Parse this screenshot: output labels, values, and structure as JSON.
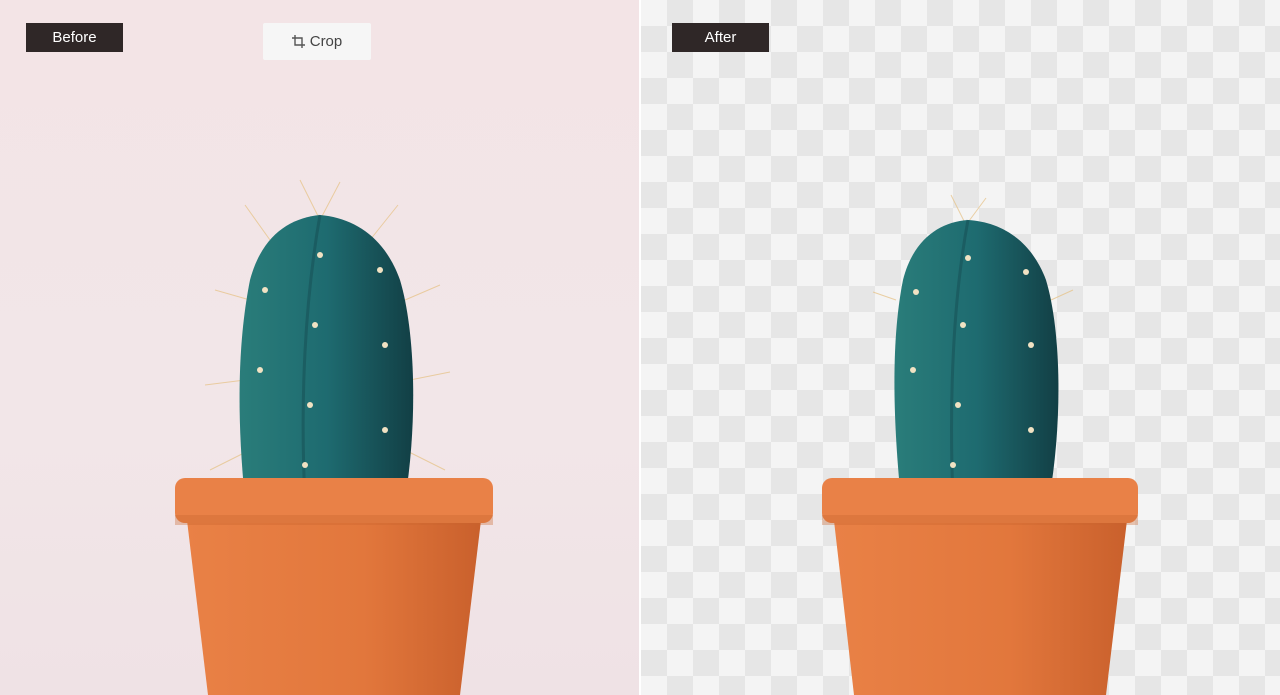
{
  "before_panel": {
    "label": "Before"
  },
  "after_panel": {
    "label": "After"
  },
  "toolbar": {
    "crop_label": "Crop",
    "crop_icon": "crop-icon"
  },
  "colors": {
    "label_bg": "#2f2727",
    "pot": "#e2773c",
    "cactus": "#1f6f6a"
  }
}
